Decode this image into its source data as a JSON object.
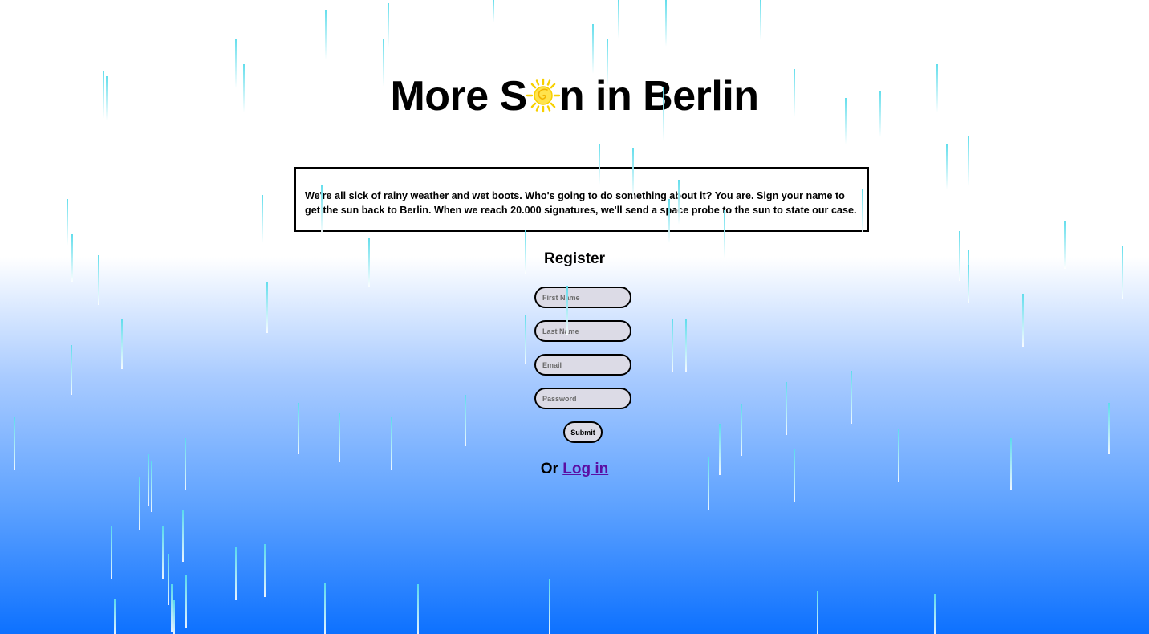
{
  "header": {
    "title_prefix": "More S",
    "title_suffix": "n in Berlin",
    "sun_icon": "sun-icon",
    "sun_color": "#f7d000"
  },
  "intro": {
    "text": "We're all sick of rainy weather and wet boots. Who's going to do something about it? You are. Sign your name to get the sun back to Berlin. When we reach 20.000 signatures, we'll send a space probe to the sun to state our case."
  },
  "register": {
    "title": "Register",
    "first_name_placeholder": "First Name",
    "last_name_placeholder": "Last Name",
    "email_placeholder": "Email",
    "password_placeholder": "Password",
    "submit_label": "Submit"
  },
  "login": {
    "prefix": "Or",
    "link_label": "Log in",
    "link_color": "#5a0ea3"
  },
  "colors": {
    "background_top": "#ffffff",
    "background_bottom": "#0d71ff",
    "rain": "#5adceb",
    "field_bg": "#dcdbe6"
  }
}
